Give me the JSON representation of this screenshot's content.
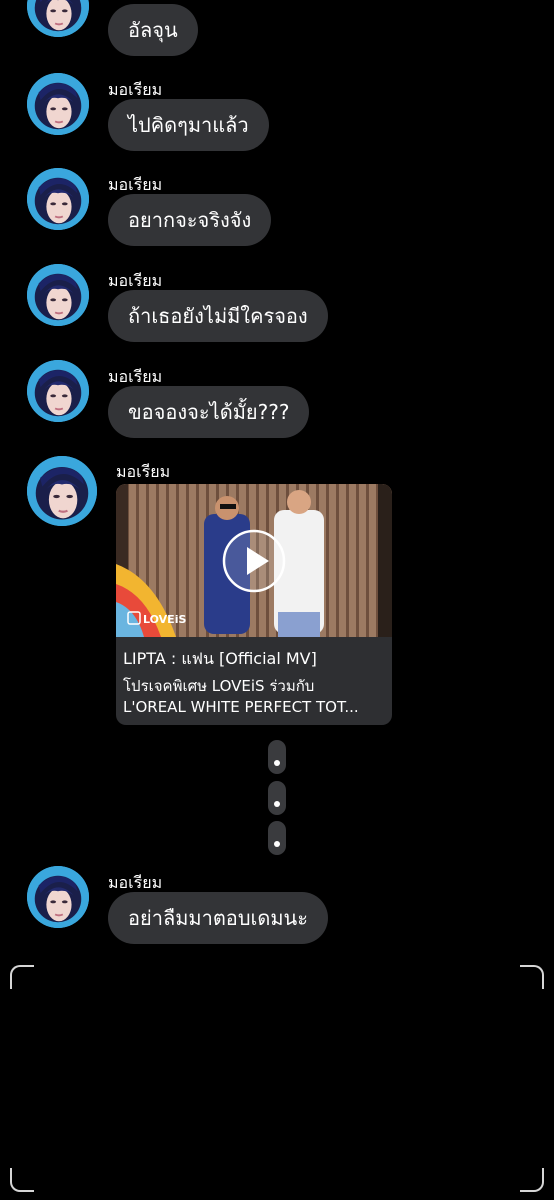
{
  "messages": [
    {
      "sender": "",
      "text": "อัลจุน"
    },
    {
      "sender": "มอเรียม",
      "text": "ไปคิดๆมาแล้ว"
    },
    {
      "sender": "มอเรียม",
      "text": "อยากจะจริงจัง"
    },
    {
      "sender": "มอเรียม",
      "text": "ถ้าเธอยังไม่มีใครจอง"
    },
    {
      "sender": "มอเรียม",
      "text": "ขอจองจะได้มั้ย???"
    }
  ],
  "link_message": {
    "sender": "มอเรียม",
    "title": "LIPTA : แฟน [Official MV]",
    "description_line1": "โปรเจคพิเศษ LOVEiS ร่วมกับ",
    "description_line2": "L'OREAL WHITE PERFECT TOT...",
    "thumbnail_logo": "LOVEiS",
    "play_icon": "play-icon"
  },
  "last_message": {
    "sender": "มอเรียม",
    "text": "อย่าลืมมาตอบเดมนะ"
  },
  "colors": {
    "background": "#000000",
    "bubble": "#333437",
    "avatar_bg": "#2aa0d8"
  }
}
